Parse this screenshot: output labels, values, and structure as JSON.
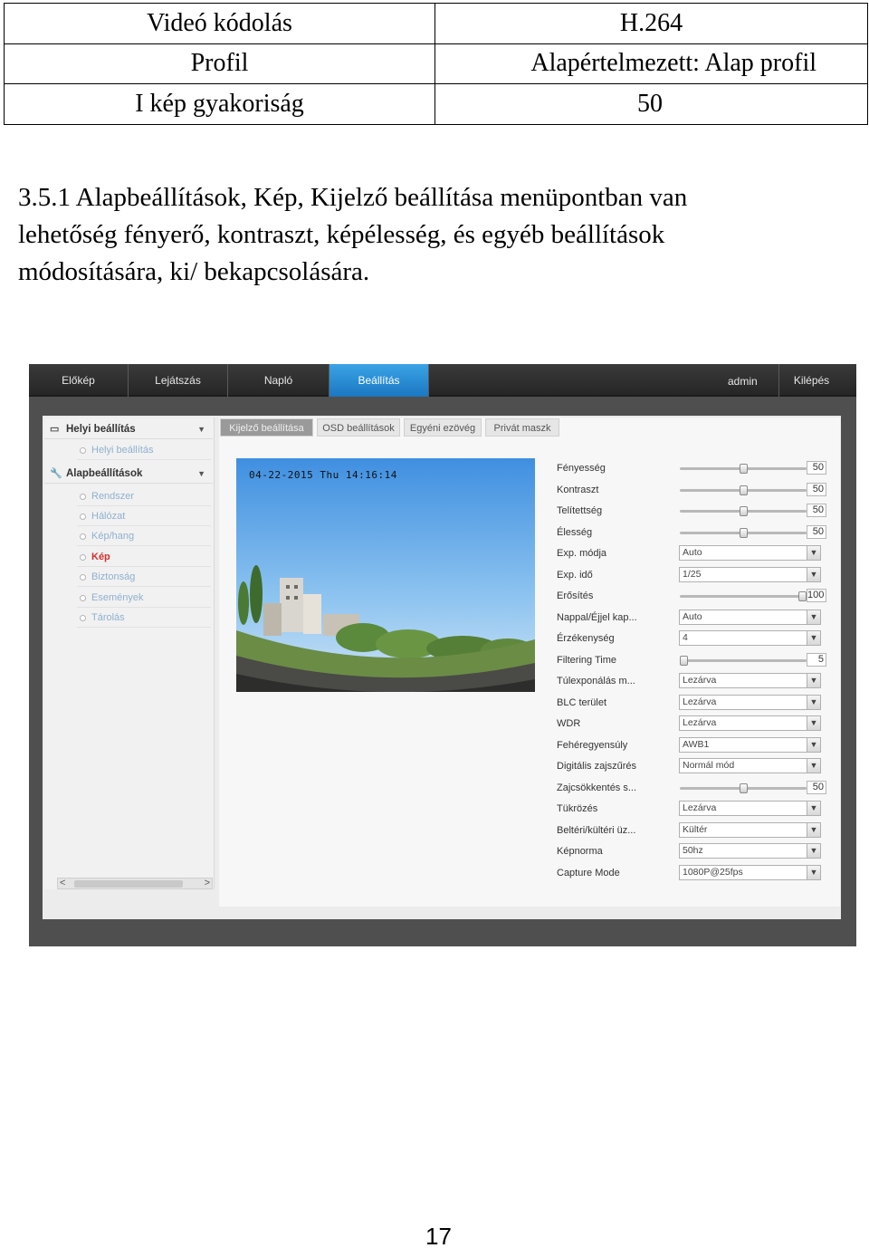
{
  "table": {
    "rows": [
      {
        "label": "Videó kódolás",
        "value": "H.264"
      },
      {
        "label": "Profil",
        "value": "Alapértelmezett: Alap profil"
      },
      {
        "label": "I kép gyakoriság",
        "value": "50"
      }
    ]
  },
  "paragraph": {
    "line1": "3.5.1 Alapbeállítások, Kép, Kijelző beállítása menüpontban van",
    "line2": "lehetőség fényerő, kontraszt, képélesség, és egyéb beállítások",
    "line3": "módosítására, ki/ bekapcsolására."
  },
  "app": {
    "nav": {
      "tabs": [
        "Előkép",
        "Lejátszás",
        "Napló",
        "Beállítás"
      ],
      "active_tab": "Beállítás",
      "user": "admin",
      "logout": "Kilépés"
    },
    "sidebar": {
      "section1": {
        "title": "Helyi beállítás",
        "items": [
          "Helyi beállítás"
        ]
      },
      "section2": {
        "title": "Alapbeállítások",
        "items": [
          "Rendszer",
          "Hálózat",
          "Kép/hang",
          "Kép",
          "Biztonság",
          "Események",
          "Tárolás"
        ]
      },
      "active_item": "Kép",
      "scroll_left": "<",
      "scroll_right": ">"
    },
    "subtabs": [
      "Kijelző beállítása",
      "OSD beállítások",
      "Egyéni ezövég",
      "Privát maszk"
    ],
    "active_subtab": "Kijelző beállítása",
    "preview_timestamp": "04-22-2015 Thu 14:16:14",
    "settings": [
      {
        "label": "Fényesség",
        "type": "slider",
        "value": "50",
        "level": 0.5
      },
      {
        "label": "Kontraszt",
        "type": "slider",
        "value": "50",
        "level": 0.5
      },
      {
        "label": "Telítettség",
        "type": "slider",
        "value": "50",
        "level": 0.5
      },
      {
        "label": "Élesség",
        "type": "slider",
        "value": "50",
        "level": 0.5
      },
      {
        "label": "Exp. módja",
        "type": "select",
        "value": "Auto"
      },
      {
        "label": "Exp. idő",
        "type": "select",
        "value": "1/25"
      },
      {
        "label": "Erősítés",
        "type": "slider",
        "value": "100",
        "level": 1.0
      },
      {
        "label": "Nappal/Éjjel kap...",
        "type": "select",
        "value": "Auto"
      },
      {
        "label": "Érzékenység",
        "type": "select",
        "value": "4"
      },
      {
        "label": "Filtering Time",
        "type": "slider",
        "value": "5",
        "level": 0.0
      },
      {
        "label": "Túlexponálás m...",
        "type": "select",
        "value": "Lezárva"
      },
      {
        "label": "BLC terület",
        "type": "select",
        "value": "Lezárva"
      },
      {
        "label": "WDR",
        "type": "select",
        "value": "Lezárva"
      },
      {
        "label": "Fehéregyensúly",
        "type": "select",
        "value": "AWB1"
      },
      {
        "label": "Digitális zajszűrés",
        "type": "select",
        "value": "Normál mód"
      },
      {
        "label": "Zajcsökkentés s...",
        "type": "slider",
        "value": "50",
        "level": 0.5
      },
      {
        "label": "Tükrözés",
        "type": "select",
        "value": "Lezárva"
      },
      {
        "label": "Beltéri/kültéri üz...",
        "type": "select",
        "value": "Kültér"
      },
      {
        "label": "Képnorma",
        "type": "select",
        "value": "50hz"
      },
      {
        "label": "Capture Mode",
        "type": "select",
        "value": "1080P@25fps"
      }
    ]
  },
  "page_number": "17"
}
